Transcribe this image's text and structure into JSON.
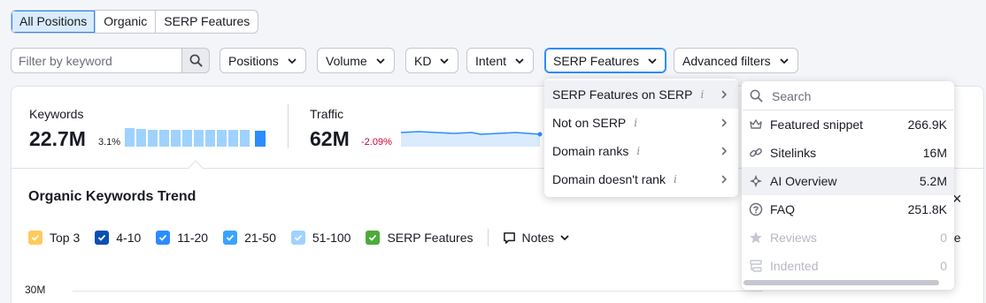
{
  "position_tabs": [
    {
      "label": "All Positions",
      "active": true
    },
    {
      "label": "Organic",
      "active": false
    },
    {
      "label": "SERP Features",
      "active": false
    }
  ],
  "filters": {
    "keyword_placeholder": "Filter by keyword",
    "search_icon": "search-icon",
    "dropdowns": [
      "Positions",
      "Volume",
      "KD",
      "Intent",
      "SERP Features",
      "Advanced filters"
    ]
  },
  "metrics": {
    "keywords": {
      "label": "Keywords",
      "value": "22.7M",
      "delta": "3.1%",
      "delta_color": "#191b23"
    },
    "traffic": {
      "label": "Traffic",
      "value": "62M",
      "delta": "-2.09%",
      "delta_color": "#d1002f"
    }
  },
  "trend": {
    "title": "Organic Keywords Trend",
    "legend": [
      {
        "label": "Top 3",
        "color": "#ffca5c"
      },
      {
        "label": "4-10",
        "color": "#0a4fb4"
      },
      {
        "label": "11-20",
        "color": "#2b8cff"
      },
      {
        "label": "21-50",
        "color": "#3aa3ff"
      },
      {
        "label": "51-100",
        "color": "#9fd2ff"
      },
      {
        "label": "SERP Features",
        "color": "#4cab3a"
      }
    ],
    "notes_label": "Notes",
    "y_tick": "30M",
    "clipped_text": "ne"
  },
  "serp_menu": {
    "items": [
      {
        "label": "SERP Features on SERP",
        "highlighted": true
      },
      {
        "label": "Not on SERP",
        "highlighted": false
      },
      {
        "label": "Domain ranks",
        "highlighted": false
      },
      {
        "label": "Domain doesn't rank",
        "highlighted": false
      }
    ],
    "info_glyph": "i"
  },
  "serp_submenu": {
    "search_placeholder": "Search",
    "items": [
      {
        "label": "Featured snippet",
        "count": "266.9K",
        "icon": "crown-icon",
        "disabled": false,
        "highlighted": false
      },
      {
        "label": "Sitelinks",
        "count": "16M",
        "icon": "link-icon",
        "disabled": false,
        "highlighted": false
      },
      {
        "label": "AI Overview",
        "count": "5.2M",
        "icon": "ai-overview-icon",
        "disabled": false,
        "highlighted": true
      },
      {
        "label": "FAQ",
        "count": "251.8K",
        "icon": "question-icon",
        "disabled": false,
        "highlighted": false
      },
      {
        "label": "Reviews",
        "count": "0",
        "icon": "star-icon",
        "disabled": true,
        "highlighted": false
      },
      {
        "label": "Indented",
        "count": "0",
        "icon": "indented-icon",
        "disabled": true,
        "highlighted": false
      }
    ]
  },
  "close_glyph": "×"
}
